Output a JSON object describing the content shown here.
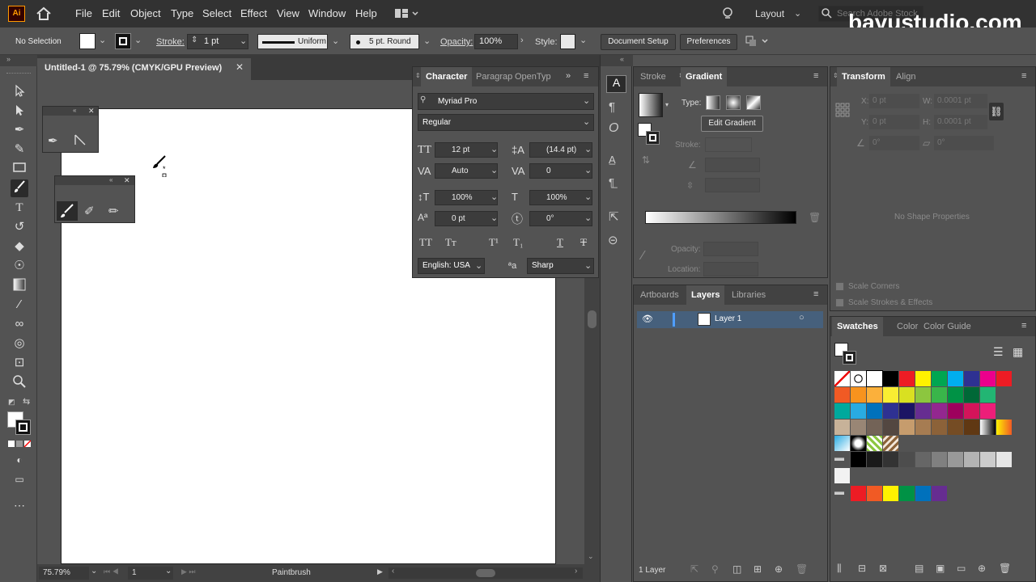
{
  "app": {
    "logo": "Ai"
  },
  "menu": [
    "File",
    "Edit",
    "Object",
    "Type",
    "Select",
    "Effect",
    "View",
    "Window",
    "Help"
  ],
  "workspace": {
    "label": "Layout",
    "search_placeholder": "Search Adobe Stock"
  },
  "watermark": "bayustudio.com",
  "control_bar": {
    "selection": "No Selection",
    "stroke_label": "Stroke:",
    "stroke_weight": "1 pt",
    "profile": "Uniform",
    "brush": "5 pt. Round",
    "opacity_label": "Opacity:",
    "opacity": "100%",
    "style_label": "Style:",
    "doc_setup": "Document Setup",
    "preferences": "Preferences"
  },
  "document": {
    "tab_title": "Untitled-1 @ 75.79% (CMYK/GPU Preview)"
  },
  "character_panel": {
    "tabs": [
      "Character",
      "Paragrap",
      "OpenTyp"
    ],
    "font_family": "Myriad Pro",
    "font_style": "Regular",
    "font_size": "12 pt",
    "leading": "(14.4 pt)",
    "kerning": "Auto",
    "tracking": "0",
    "vscale": "100%",
    "hscale": "100%",
    "baseline": "0 pt",
    "rotation": "0°",
    "language": "English: USA",
    "antialias": "Sharp"
  },
  "gradient_panel": {
    "tabs": [
      "Stroke",
      "Gradient"
    ],
    "type_label": "Type:",
    "edit_btn": "Edit Gradient",
    "stroke_label": "Stroke:",
    "opacity_label": "Opacity:",
    "location_label": "Location:"
  },
  "layers_panel": {
    "tabs": [
      "Artboards",
      "Layers",
      "Libraries"
    ],
    "layer_name": "Layer 1",
    "footer": "1 Layer"
  },
  "transform_panel": {
    "tabs": [
      "Transform",
      "Align"
    ],
    "x": "0 pt",
    "y": "0 pt",
    "w": "0.0001 pt",
    "h": "0.0001 pt",
    "rot": "0°",
    "shear": "0°",
    "x_label": "X:",
    "y_label": "Y:",
    "w_label": "W:",
    "h_label": "H:",
    "empty": "No Shape Properties",
    "scale_corners": "Scale Corners",
    "scale_strokes": "Scale Strokes & Effects"
  },
  "swatches_panel": {
    "tabs": [
      "Swatches",
      "Color",
      "Color Guide"
    ],
    "row1": [
      "#ffffff",
      "#000000",
      "#ed1c24",
      "#fff200",
      "#00a651",
      "#00aeef",
      "#2e3192",
      "#ec008c",
      "#ed1c24"
    ],
    "row2": [
      "#f15a24",
      "#f7931e",
      "#fbb03b",
      "#f9ed32",
      "#d9e021",
      "#8cc63f",
      "#39b54a",
      "#009245",
      "#006837",
      "#22b573"
    ],
    "row3": [
      "#00a99d",
      "#29abe2",
      "#0071bc",
      "#2e3192",
      "#1b1464",
      "#662d91",
      "#93278f",
      "#9e005d",
      "#d4145a",
      "#ed1e79"
    ],
    "row4": [
      "#c7b299",
      "#998675",
      "#736357",
      "#534741",
      "#c69c6d",
      "#a67c52",
      "#8c6239",
      "#754c24",
      "#603813",
      "#42210b"
    ],
    "row6": [
      "#000000",
      "#1a1a1a",
      "#333333",
      "#4d4d4d",
      "#666666",
      "#808080",
      "#999999",
      "#b3b3b3",
      "#cccccc",
      "#e6e6e6"
    ],
    "row8": [
      "#ed1c24",
      "#f15a24",
      "#fff200",
      "#009245",
      "#0071bc",
      "#662d91"
    ]
  },
  "status_bar": {
    "zoom": "75.79%",
    "page": "1",
    "tool": "Paintbrush"
  }
}
